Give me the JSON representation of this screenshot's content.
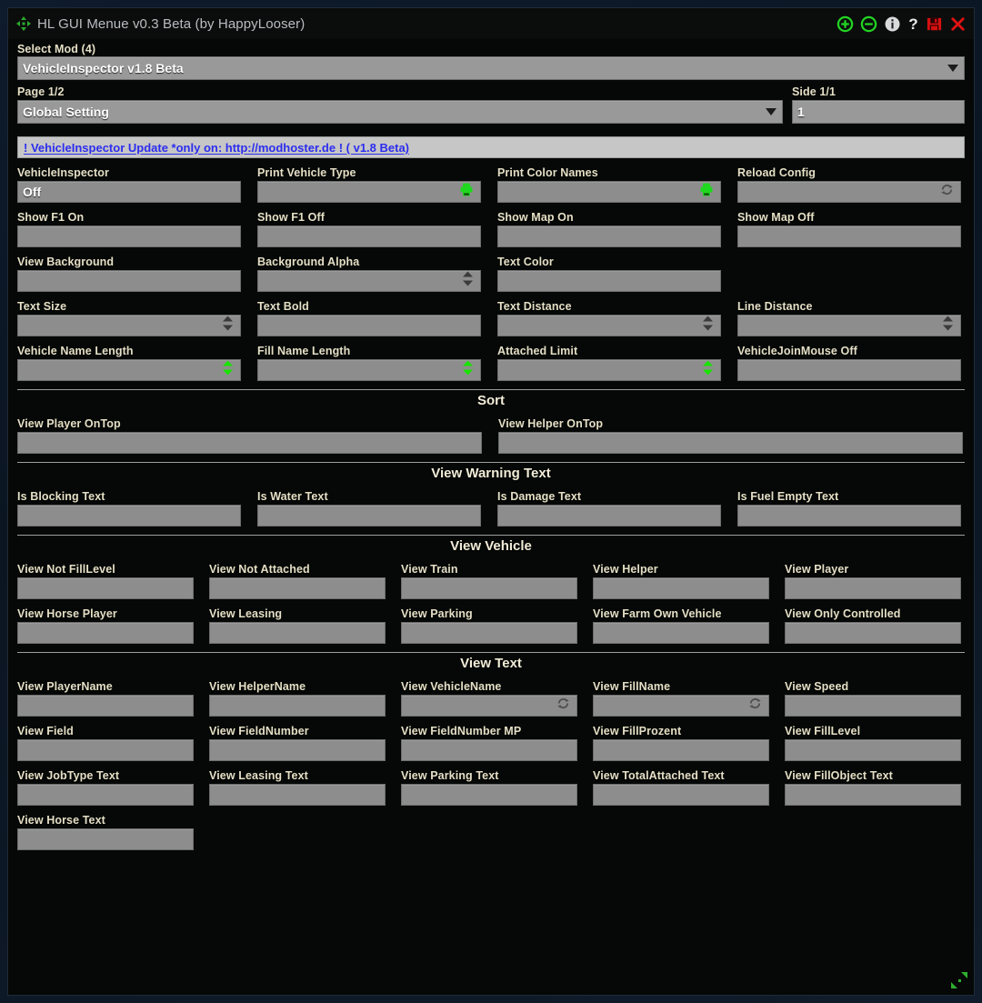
{
  "window": {
    "title": "HL GUI Menue v0.3 Beta (by HappyLooser)",
    "move_icon": "move-arrows-icon",
    "titlebar_icons": [
      {
        "name": "zoom-in-icon",
        "label": "+"
      },
      {
        "name": "zoom-out-icon",
        "label": "-"
      },
      {
        "name": "info-icon",
        "label": "i"
      },
      {
        "name": "help-icon",
        "label": "?"
      },
      {
        "name": "save-icon",
        "label": "save"
      },
      {
        "name": "close-icon",
        "label": "x"
      }
    ],
    "resize_handle": "resize-grip-icon"
  },
  "selectors": {
    "mod_label": "Select Mod (4)",
    "mod_value": "VehicleInspector v1.8 Beta",
    "page_label": "Page 1/2",
    "page_value": "Global Setting",
    "side_label": "Side 1/1",
    "side_value": "1"
  },
  "notice": {
    "text": "! VehicleInspector Update *only on: http://modhoster.de ! ( v1.8 Beta)"
  },
  "colors": {
    "led_green": "#18e400",
    "led_red": "#e41200",
    "led_off": "#4a4a4a",
    "label": "#e5dfc6",
    "field": "#8d8d8d",
    "link": "#2d2df0",
    "panel": "#050806"
  },
  "main_grid": [
    [
      {
        "label": "VehicleInspector",
        "value": "Off",
        "control": "led",
        "state": "red"
      },
      {
        "label": "Print Vehicle Type",
        "value": "",
        "control": "printer",
        "state": "green"
      },
      {
        "label": "Print Color Names",
        "value": "",
        "control": "printer",
        "state": "green"
      },
      {
        "label": "Reload Config",
        "value": "",
        "control": "refresh",
        "state": "grey"
      }
    ],
    [
      {
        "label": "Show F1 On",
        "value": "",
        "control": "led",
        "state": "green"
      },
      {
        "label": "Show F1 Off",
        "value": "",
        "control": "led",
        "state": "green"
      },
      {
        "label": "Show Map On",
        "value": "",
        "control": "led",
        "state": "green"
      },
      {
        "label": "Show Map Off",
        "value": "",
        "control": "led",
        "state": "green"
      }
    ],
    [
      {
        "label": "View Background",
        "value": "",
        "control": "led",
        "state": "green"
      },
      {
        "label": "Background Alpha",
        "value": "",
        "control": "spinner",
        "state": "grey"
      },
      {
        "label": "Text Color",
        "value": "",
        "control": "led",
        "state": "green"
      },
      {
        "label": "",
        "value": "",
        "control": "none",
        "state": ""
      }
    ],
    [
      {
        "label": "Text Size",
        "value": "",
        "control": "spinner",
        "state": "grey"
      },
      {
        "label": "Text Bold",
        "value": "",
        "control": "led",
        "state": "off"
      },
      {
        "label": "Text Distance",
        "value": "",
        "control": "spinner",
        "state": "grey"
      },
      {
        "label": "Line Distance",
        "value": "",
        "control": "spinner",
        "state": "grey"
      }
    ],
    [
      {
        "label": "Vehicle Name Length",
        "value": "",
        "control": "spinner",
        "state": "green"
      },
      {
        "label": "Fill Name Length",
        "value": "",
        "control": "spinner",
        "state": "green"
      },
      {
        "label": "Attached Limit",
        "value": "",
        "control": "spinner",
        "state": "green"
      },
      {
        "label": "VehicleJoinMouse Off",
        "value": "",
        "control": "led",
        "state": "green"
      }
    ]
  ],
  "sections": [
    {
      "title": "Sort",
      "columns": 2,
      "rows": [
        [
          {
            "label": "View Player OnTop",
            "value": "",
            "control": "led",
            "state": "green"
          },
          {
            "label": "View Helper OnTop",
            "value": "",
            "control": "led",
            "state": "green"
          }
        ]
      ]
    },
    {
      "title": "View Warning Text",
      "columns": 4,
      "rows": [
        [
          {
            "label": "Is Blocking Text",
            "value": "",
            "control": "led",
            "state": "green"
          },
          {
            "label": "Is Water Text",
            "value": "",
            "control": "led",
            "state": "green"
          },
          {
            "label": "Is Damage Text",
            "value": "",
            "control": "led",
            "state": "green"
          },
          {
            "label": "Is Fuel Empty Text",
            "value": "",
            "control": "led",
            "state": "green"
          }
        ]
      ]
    },
    {
      "title": "View Vehicle",
      "columns": 5,
      "rows": [
        [
          {
            "label": "View Not FillLevel",
            "value": "",
            "control": "led",
            "state": "green"
          },
          {
            "label": "View Not Attached",
            "value": "",
            "control": "led",
            "state": "green"
          },
          {
            "label": "View Train",
            "value": "",
            "control": "led",
            "state": "green"
          },
          {
            "label": "View Helper",
            "value": "",
            "control": "led",
            "state": "green"
          },
          {
            "label": "View Player",
            "value": "",
            "control": "led",
            "state": "green"
          }
        ],
        [
          {
            "label": "View Horse Player",
            "value": "",
            "control": "led",
            "state": "green"
          },
          {
            "label": "View Leasing",
            "value": "",
            "control": "led",
            "state": "green"
          },
          {
            "label": "View Parking",
            "value": "",
            "control": "led",
            "state": "green"
          },
          {
            "label": "View Farm Own Vehicle",
            "value": "",
            "control": "led",
            "state": "green"
          },
          {
            "label": "View Only Controlled",
            "value": "",
            "control": "led",
            "state": "green"
          }
        ]
      ]
    },
    {
      "title": "View Text",
      "columns": 5,
      "rows": [
        [
          {
            "label": "View PlayerName",
            "value": "",
            "control": "led",
            "state": "green"
          },
          {
            "label": "View HelperName",
            "value": "",
            "control": "led",
            "state": "green"
          },
          {
            "label": "View VehicleName",
            "value": "",
            "control": "refresh",
            "state": "grey"
          },
          {
            "label": "View FillName",
            "value": "",
            "control": "refresh",
            "state": "grey"
          },
          {
            "label": "View Speed",
            "value": "",
            "control": "led",
            "state": "green"
          }
        ],
        [
          {
            "label": "View Field",
            "value": "",
            "control": "led",
            "state": "green"
          },
          {
            "label": "View FieldNumber",
            "value": "",
            "control": "led",
            "state": "green"
          },
          {
            "label": "View FieldNumber MP",
            "value": "",
            "control": "led",
            "state": "green"
          },
          {
            "label": "View FillProzent",
            "value": "",
            "control": "led",
            "state": "green"
          },
          {
            "label": "View FillLevel",
            "value": "",
            "control": "led",
            "state": "green"
          }
        ],
        [
          {
            "label": "View JobType Text",
            "value": "",
            "control": "led",
            "state": "green"
          },
          {
            "label": "View Leasing Text",
            "value": "",
            "control": "led",
            "state": "green"
          },
          {
            "label": "View Parking Text",
            "value": "",
            "control": "led",
            "state": "green"
          },
          {
            "label": "View TotalAttached Text",
            "value": "",
            "control": "led",
            "state": "green"
          },
          {
            "label": "View FillObject Text",
            "value": "",
            "control": "led",
            "state": "green"
          }
        ],
        [
          {
            "label": "View Horse Text",
            "value": "",
            "control": "led",
            "state": "green"
          }
        ]
      ]
    }
  ]
}
